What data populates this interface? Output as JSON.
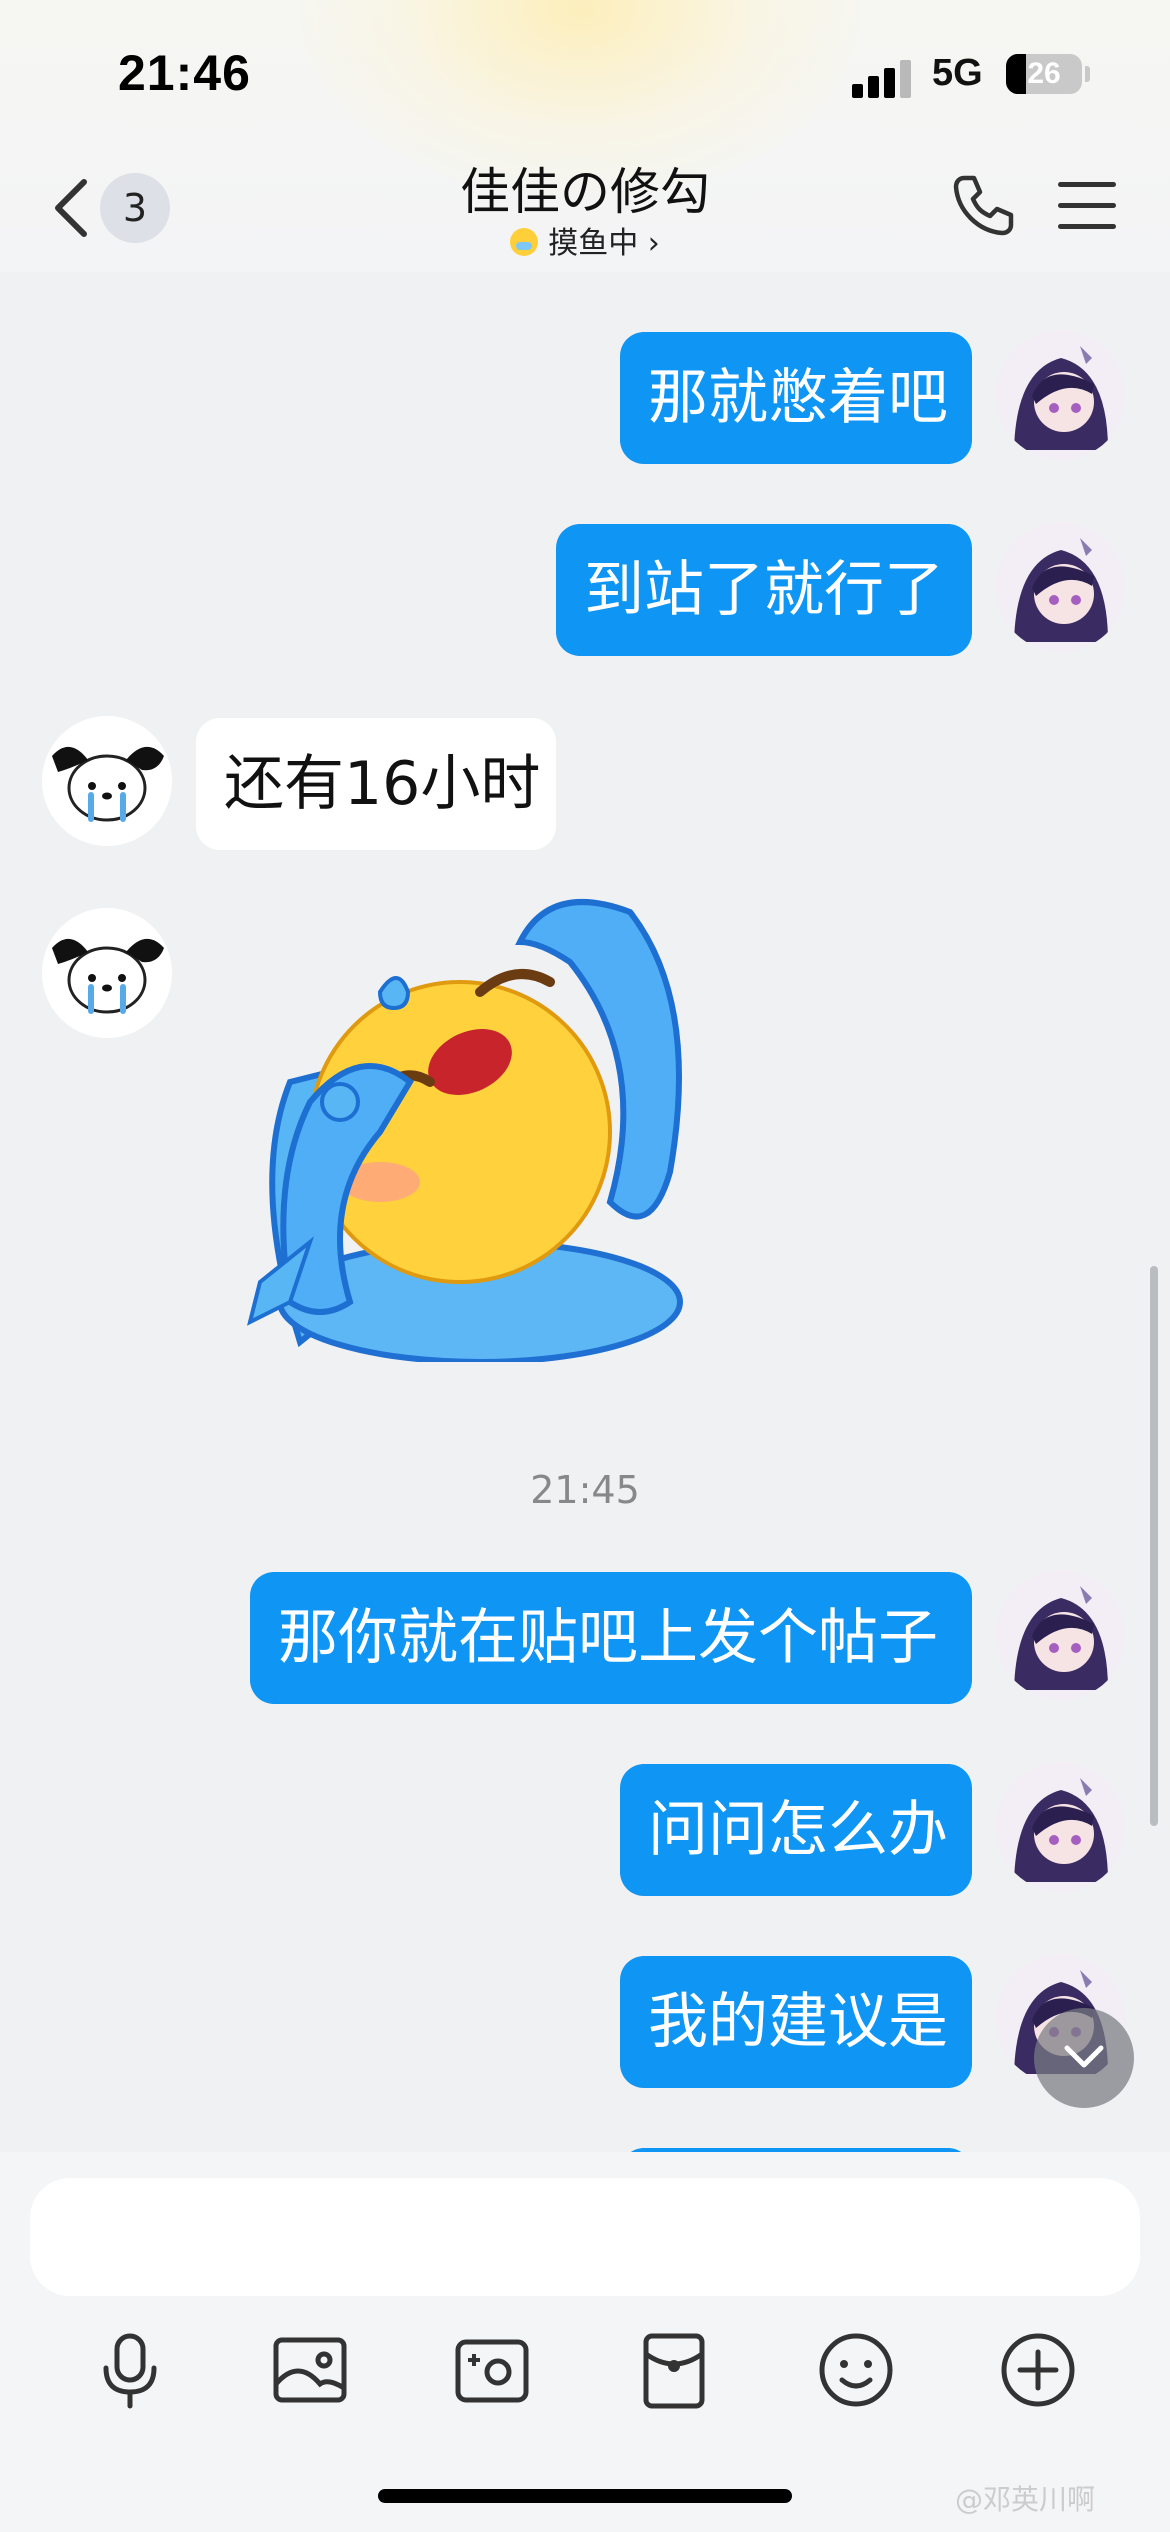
{
  "status_bar": {
    "time": "21:46",
    "network": "5G",
    "battery": 26
  },
  "header": {
    "back_count": "3",
    "title": "佳佳の修勾",
    "status": "摸鱼中",
    "status_chevron": "›",
    "icons": [
      "back-chevron-icon",
      "phone-icon",
      "menu-icon"
    ]
  },
  "messages": [
    {
      "side": "out",
      "text": "那就憋着吧"
    },
    {
      "side": "out",
      "text": "到站了就行了"
    },
    {
      "side": "in",
      "text": "还有16小时"
    },
    {
      "side": "in",
      "type": "sticker",
      "sticker": "crying-emoji-sticker"
    },
    {
      "type": "time",
      "text": "21:45"
    },
    {
      "side": "out",
      "text": "那你就在贴吧上发个帖子"
    },
    {
      "side": "out",
      "text": "问问怎么办"
    },
    {
      "side": "out",
      "text": "我的建议是"
    }
  ],
  "input": {
    "placeholder": ""
  },
  "toolbar": [
    "microphone-icon",
    "image-icon",
    "camera-icon",
    "red-packet-icon",
    "emoji-icon",
    "plus-icon"
  ],
  "watermark": "@邓英川啊",
  "colors": {
    "out_bubble": "#0f95f3",
    "in_bubble": "#ffffff",
    "background": "#f0f1f3"
  }
}
